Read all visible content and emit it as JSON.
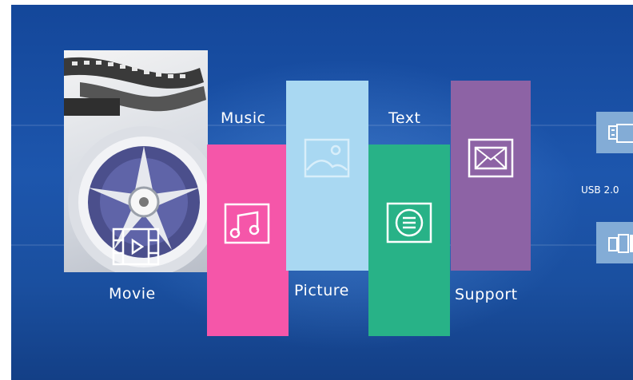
{
  "menu": {
    "movie_label": "Movie",
    "music_label": "Music",
    "picture_label": "Picture",
    "text_label": "Text",
    "support_label": "Support"
  },
  "device": {
    "usb_label": "USB 2.0"
  },
  "icons": {
    "movie": "film-reel-icon",
    "music": "music-note-icon",
    "picture": "picture-icon",
    "text": "document-icon",
    "support": "envelope-icon",
    "usb_top": "usb-drive-icon",
    "usb_bottom": "usb-port-icon"
  },
  "colors": {
    "background": "#1b52a6",
    "music": "#f556a9",
    "picture": "#a9d8f2",
    "text": "#28b287",
    "support": "#8d63a5",
    "usb_button": "#83acd6"
  }
}
